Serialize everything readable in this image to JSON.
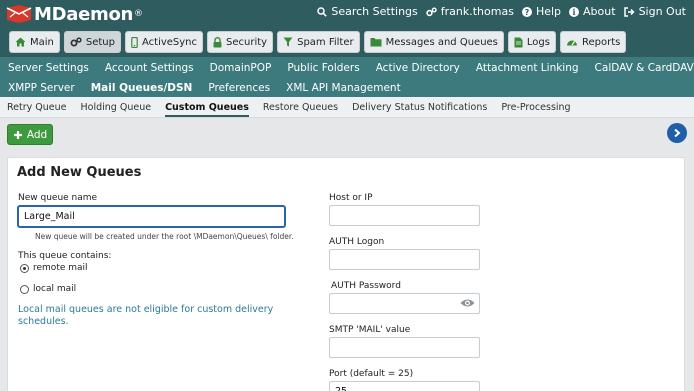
{
  "app": {
    "brand": "MDaemon",
    "brand_mark": "®"
  },
  "toplinks": [
    {
      "label": "Search Settings",
      "icon": "search-icon"
    },
    {
      "label": "frank.thomas",
      "icon": "gear-icon"
    },
    {
      "label": "Help",
      "icon": "question-icon"
    },
    {
      "label": "About",
      "icon": "info-icon"
    },
    {
      "label": "Sign Out",
      "icon": "sign-out-icon"
    }
  ],
  "navbuttons": [
    {
      "label": "Main",
      "icon": "home-icon",
      "active": false
    },
    {
      "label": "Setup",
      "icon": "cogs-icon",
      "active": true
    },
    {
      "label": "ActiveSync",
      "icon": "mobile-icon",
      "active": false
    },
    {
      "label": "Security",
      "icon": "lock-icon",
      "active": false
    },
    {
      "label": "Spam Filter",
      "icon": "filter-icon",
      "active": false
    },
    {
      "label": "Messages and Queues",
      "icon": "folder-icon",
      "active": false
    },
    {
      "label": "Logs",
      "icon": "file-icon",
      "active": false
    },
    {
      "label": "Reports",
      "icon": "dashboard-icon",
      "active": false
    }
  ],
  "subnav": {
    "row1": [
      "Server Settings",
      "Account Settings",
      "DomainPOP",
      "Public Folders",
      "Active Directory",
      "Attachment Linking",
      "CalDAV & CardDAV"
    ],
    "row2": [
      "XMPP Server",
      "Mail Queues/DSN",
      "Preferences",
      "XML API Management"
    ],
    "active": "Mail Queues/DSN"
  },
  "tabs": [
    "Retry Queue",
    "Holding Queue",
    "Custom Queues",
    "Restore Queues",
    "Delivery Status Notifications",
    "Pre-Processing"
  ],
  "active_tab": "Custom Queues",
  "actions": {
    "add_label": "Add"
  },
  "form": {
    "title": "Add New Queues",
    "queue_name_label": "New queue name",
    "queue_name_value": "Large_Mail",
    "queue_hint": "New queue will be created under the root \\MDaemon\\Queues\\ folder.",
    "contains_label": "This queue contains:",
    "option_remote": "remote mail",
    "option_local": "local mail",
    "selected_option": "remote mail",
    "local_note": "Local mail queues are not eligible for custom delivery schedules.",
    "host_label": "Host or IP",
    "host_value": "",
    "auth_logon_label": "AUTH Logon",
    "auth_logon_value": "",
    "auth_password_label": "AUTH Password",
    "auth_password_value": "",
    "smtp_mail_label": "SMTP 'MAIL' value",
    "smtp_mail_value": "",
    "port_label": "Port (default = 25)",
    "port_value": "25"
  },
  "colors": {
    "header": "#2f5c5f",
    "subnav": "#3d7a7d",
    "add_button": "#3f9a3f",
    "focus": "#2a64b0",
    "note": "#2b7a96"
  }
}
